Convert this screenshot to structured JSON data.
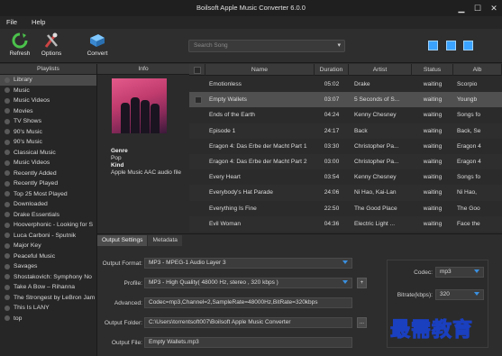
{
  "window": {
    "title": "Boilsoft Apple Music Converter 6.0.0"
  },
  "menu": {
    "file": "File",
    "help": "Help"
  },
  "toolbar": {
    "refresh": "Refresh",
    "options": "Options",
    "convert": "Convert"
  },
  "search": {
    "placeholder": "Search Song"
  },
  "playlists": {
    "header": "Playlists",
    "items": [
      "Library",
      "Music",
      "Music Videos",
      "Movies",
      "TV Shows",
      "90's Music",
      "90's Music",
      "Classical Music",
      "Music Videos",
      "Recently Added",
      "Recently Played",
      "Top 25 Most Played",
      "Downloaded",
      "Drake Essentials",
      "Hooverphonic - Looking for S",
      "Luca Carboni - Sputnik",
      "Major Key",
      "Peaceful Music",
      "Savages",
      "Shostakovich: Symphony No",
      "Take A Bow – Rihanna",
      "The Strongest by LeBron Jam",
      "This Is LANY",
      "top"
    ]
  },
  "info": {
    "header": "Info",
    "genre_label": "Genre",
    "genre": "Pop",
    "kind_label": "Kind",
    "kind": "Apple Music AAC audio file"
  },
  "table": {
    "columns": [
      "Name",
      "Duration",
      "Artist",
      "Status",
      "Alb"
    ],
    "rows": [
      {
        "name": "Emotionless",
        "duration": "05:02",
        "artist": "Drake",
        "status": "waiting",
        "album": "Scorpio"
      },
      {
        "name": "Empty Wallets",
        "duration": "03:07",
        "artist": "5 Seconds of S...",
        "status": "waiting",
        "album": "Youngb"
      },
      {
        "name": "Ends of the Earth",
        "duration": "04:24",
        "artist": "Kenny Chesney",
        "status": "waiting",
        "album": "Songs fo"
      },
      {
        "name": "Episode 1",
        "duration": "24:17",
        "artist": "Back",
        "status": "waiting",
        "album": "Back, Se"
      },
      {
        "name": "Eragon 4: Das Erbe der Macht Part 1",
        "duration": "03:30",
        "artist": "Christopher Pa...",
        "status": "waiting",
        "album": "Eragon 4"
      },
      {
        "name": "Eragon 4: Das Erbe der Macht Part 2",
        "duration": "03:00",
        "artist": "Christopher Pa...",
        "status": "waiting",
        "album": "Eragon 4"
      },
      {
        "name": "Every Heart",
        "duration": "03:54",
        "artist": "Kenny Chesney",
        "status": "waiting",
        "album": "Songs fo"
      },
      {
        "name": "Everybody's Hat Parade",
        "duration": "24:06",
        "artist": "Ni Hao, Kai-Lan",
        "status": "waiting",
        "album": "Ni Hao,"
      },
      {
        "name": "Everything Is Fine",
        "duration": "22:50",
        "artist": "The Good Place",
        "status": "waiting",
        "album": "The Goo"
      },
      {
        "name": "Evil Woman",
        "duration": "04:36",
        "artist": "Electric Light ...",
        "status": "waiting",
        "album": "Face the"
      }
    ]
  },
  "settings": {
    "tab_output": "Output Settings",
    "tab_metadata": "Metadata",
    "output_format_label": "Output Format:",
    "output_format": "MP3 - MPEG-1 Audio Layer 3",
    "profile_label": "Profile:",
    "profile": "MP3 - High Quality( 48000 Hz, stereo , 320 kbps )",
    "advanced_label": "Advanced:",
    "advanced": "Codec=mp3,Channel=2,SampleRate=48000Hz,BitRate=320kbps",
    "output_folder_label": "Output Folder:",
    "output_folder": "C:\\Users\\torrentsoft007\\Boilsoft Apple Music Converter",
    "output_file_label": "Output File:",
    "output_file": "Empty Wallets.mp3",
    "codec_label": "Codec:",
    "codec": "mp3",
    "bitrate_label": "Bitrate(kbps):",
    "bitrate": "320",
    "browse": "...",
    "plus": "+"
  },
  "watermark": "最需教育",
  "colors": {
    "accent": "#3aa3ff",
    "selected_row": "#505050",
    "panel": "#2d2d2d"
  }
}
